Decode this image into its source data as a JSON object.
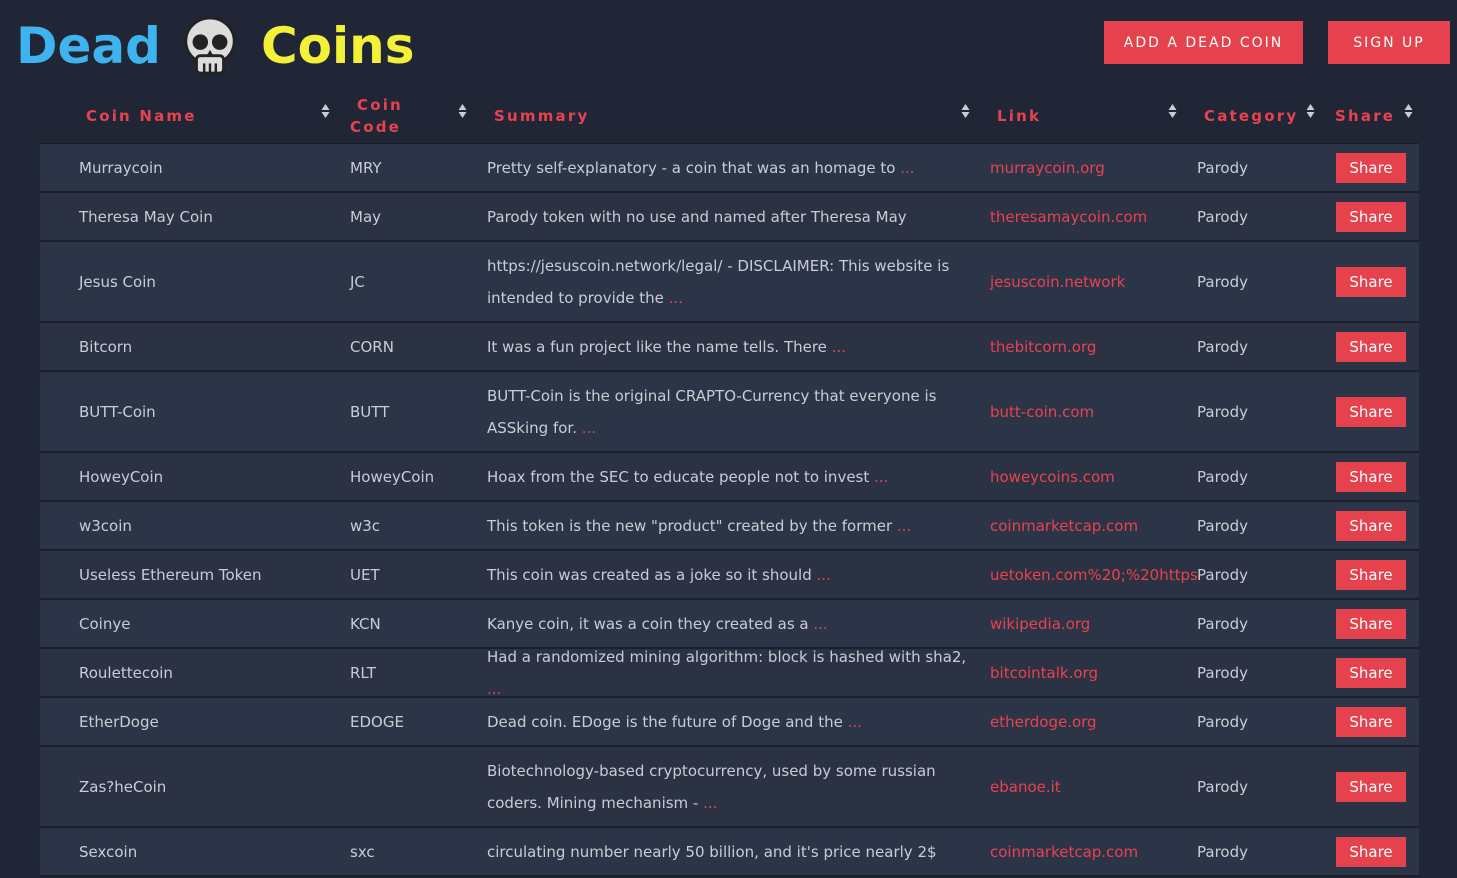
{
  "header": {
    "logo_dead": "Dead",
    "logo_coins": "Coins",
    "add_button": "ADD A DEAD COIN",
    "signup_button": "SIGN UP"
  },
  "colors": {
    "accent": "#e5424d",
    "logo_blue": "#3fb3ee",
    "logo_yellow": "#f3f038",
    "background": "#202636"
  },
  "table": {
    "columns": {
      "name": "Coin Name",
      "code_line1": "Coin",
      "code_line2": "Code",
      "summary": "Summary",
      "link": "Link",
      "category": "Category",
      "share": "Share"
    },
    "rows": [
      {
        "name": "Murraycoin",
        "code": "MRY",
        "summary": "Pretty self-explanatory - a coin that was an homage to",
        "link": "murraycoin.org",
        "category": "Parody",
        "share": "Share"
      },
      {
        "name": "Theresa May Coin",
        "code": "May",
        "summary": "Parody token with no use and named after Theresa May",
        "link": "theresamaycoin.com",
        "category": "Parody",
        "share": "Share"
      },
      {
        "name": "Jesus Coin",
        "code": "JC",
        "summary": "https://jesuscoin.network/legal/ - DISCLAIMER: This website is intended to provide the",
        "link": "jesuscoin.network",
        "category": "Parody",
        "share": "Share"
      },
      {
        "name": "Bitcorn",
        "code": "CORN",
        "summary": "It was a fun project like the name tells. There",
        "link": "thebitcorn.org",
        "category": "Parody",
        "share": "Share"
      },
      {
        "name": "BUTT-Coin",
        "code": "BUTT",
        "summary": "BUTT-Coin is the original CRAPTO-Currency that everyone is ASSking for.",
        "link": "butt-coin.com",
        "category": "Parody",
        "share": "Share"
      },
      {
        "name": "HoweyCoin",
        "code": "HoweyCoin",
        "summary": "Hoax from the SEC to educate people not to invest",
        "link": "howeycoins.com",
        "category": "Parody",
        "share": "Share"
      },
      {
        "name": "w3coin",
        "code": "w3c",
        "summary": "This token is the new \"product\" created by the former",
        "link": "coinmarketcap.com",
        "category": "Parody",
        "share": "Share"
      },
      {
        "name": "Useless Ethereum Token",
        "code": "UET",
        "summary": "This coin was created as a joke so it should",
        "link": "uetoken.com%20;%20https",
        "category": "Parody",
        "share": "Share"
      },
      {
        "name": "Coinye",
        "code": "KCN",
        "summary": "Kanye coin, it was a coin they created as a",
        "link": "wikipedia.org",
        "category": "Parody",
        "share": "Share"
      },
      {
        "name": "Roulettecoin",
        "code": "RLT",
        "summary": "Had a randomized mining algorithm: block is hashed with sha2,",
        "link": "bitcointalk.org",
        "category": "Parody",
        "share": "Share"
      },
      {
        "name": "EtherDoge",
        "code": "EDOGE",
        "summary": "Dead coin. EDoge is the future of Doge and the",
        "link": "etherdoge.org",
        "category": "Parody",
        "share": "Share"
      },
      {
        "name": "Zas?heCoin",
        "code": "",
        "summary": "Biotechnology-based cryptocurrency, used by some russian coders. Mining mechanism -",
        "link": "ebanoe.it",
        "category": "Parody",
        "share": "Share"
      },
      {
        "name": "Sexcoin",
        "code": "sxc",
        "summary": "circulating number nearly 50 billion, and it's price nearly 2$",
        "link": "coinmarketcap.com",
        "category": "Parody",
        "share": "Share"
      }
    ],
    "ellipsis": "..."
  }
}
